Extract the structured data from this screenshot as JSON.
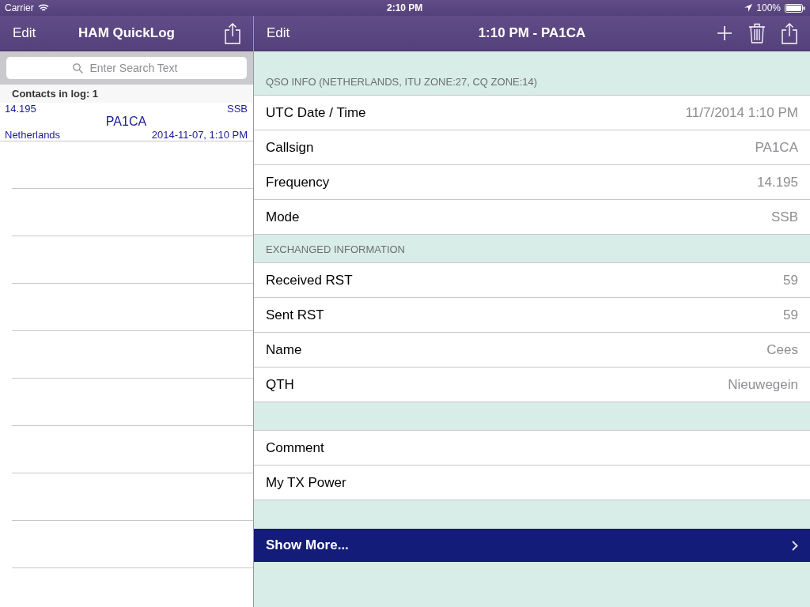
{
  "status_bar": {
    "carrier": "Carrier",
    "time": "2:10 PM",
    "battery": "100%"
  },
  "master": {
    "nav": {
      "edit": "Edit",
      "title": "HAM QuickLog"
    },
    "search": {
      "placeholder": "Enter Search Text"
    },
    "section_header": "Contacts in log: 1",
    "contacts": [
      {
        "frequency": "14.195",
        "mode": "SSB",
        "callsign": "PA1CA",
        "country": "Netherlands",
        "datetime": "2014-11-07, 1:10 PM"
      }
    ]
  },
  "detail": {
    "nav": {
      "edit": "Edit",
      "title": "1:10 PM - PA1CA"
    },
    "sections": [
      {
        "header": "QSO INFO (NETHERLANDS, ITU ZONE:27, CQ ZONE:14)",
        "rows": [
          {
            "label": "UTC Date / Time",
            "value": "11/7/2014 1:10 PM"
          },
          {
            "label": "Callsign",
            "value": "PA1CA"
          },
          {
            "label": "Frequency",
            "value": "14.195"
          },
          {
            "label": "Mode",
            "value": "SSB"
          }
        ]
      },
      {
        "header": "EXCHANGED INFORMATION",
        "rows": [
          {
            "label": "Received RST",
            "value": "59"
          },
          {
            "label": "Sent RST",
            "value": "59"
          },
          {
            "label": "Name",
            "value": "Cees"
          },
          {
            "label": "QTH",
            "value": "Nieuwegein"
          }
        ]
      },
      {
        "rows": [
          {
            "label": "Comment"
          },
          {
            "label": "My TX Power"
          }
        ]
      }
    ],
    "show_more": "Show More..."
  }
}
